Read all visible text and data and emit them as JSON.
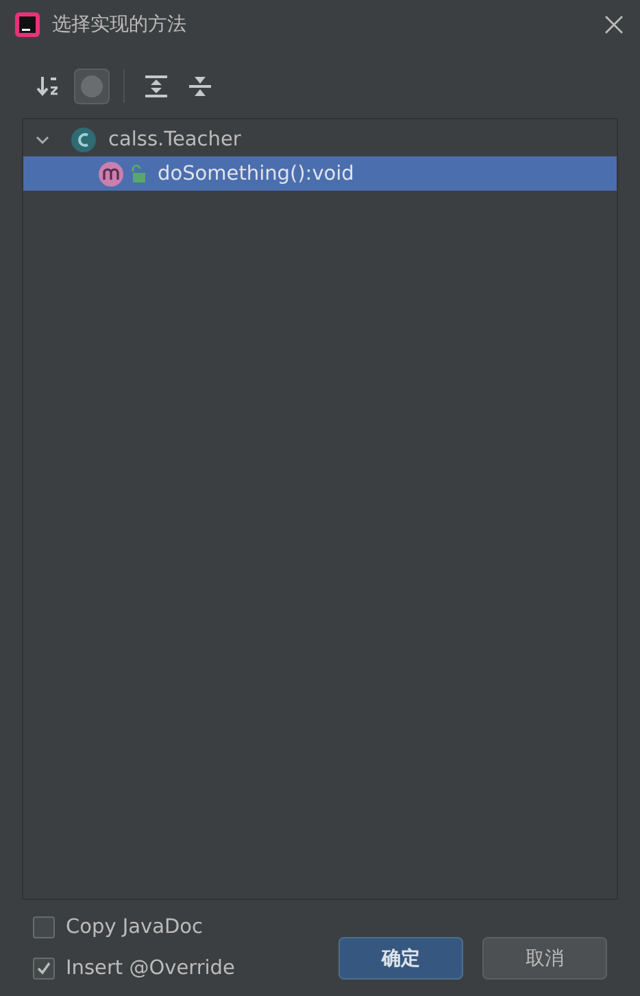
{
  "window": {
    "title": "选择实现的方法"
  },
  "toolbar": [
    {
      "kind": "sort",
      "on": false
    },
    {
      "kind": "filter",
      "on": true
    },
    {
      "kind": "expand",
      "on": false
    },
    {
      "kind": "collapse",
      "on": false
    }
  ],
  "tree": [
    {
      "kind": "class",
      "label": "calss.Teacher",
      "expanded": true,
      "selected": false,
      "children": [
        {
          "kind": "method",
          "label": "doSomething():void",
          "selected": true
        }
      ]
    }
  ],
  "options": [
    {
      "label": "Copy JavaDoc",
      "checked": false
    },
    {
      "label": "Insert @Override",
      "checked": true
    }
  ],
  "buttons": [
    {
      "label": "确定",
      "primary": true
    },
    {
      "label": "取消",
      "primary": false
    }
  ]
}
